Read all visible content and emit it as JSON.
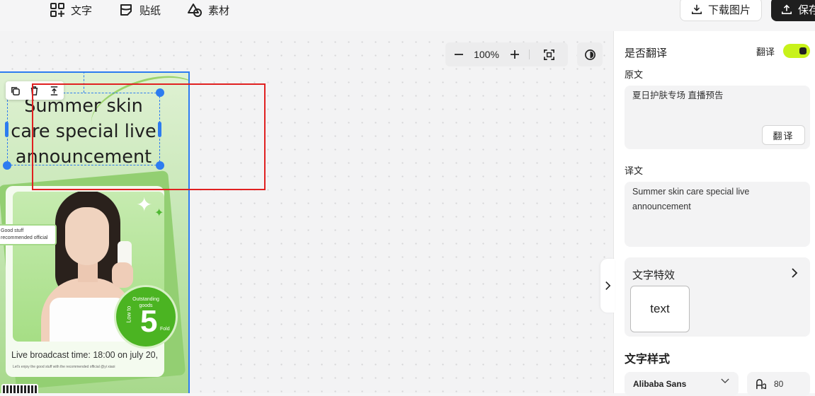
{
  "toolbar": {
    "text_label": "文字",
    "sticker_label": "贴纸",
    "material_label": "素材",
    "download_label": "下载图片",
    "save_label": "保存"
  },
  "canvas": {
    "zoom_level": "100%"
  },
  "poster": {
    "title_line1": "Summer skin",
    "title_line2": "care special live",
    "title_line3": "announcement",
    "sticker_line1": "Good stuff",
    "sticker_line2": "recommended official",
    "badge_top_line1": "Outstanding",
    "badge_top_line2": "goods",
    "badge_side": "Low to",
    "badge_number": "5",
    "badge_unit": "Fold",
    "live_time": "Live broadcast time: 18:00 on july 20,",
    "tiny_text": "Let's enjoy the good stuff with the recommended official @yi xiaoi"
  },
  "panel": {
    "translate_toggle_label": "是否翻译",
    "toggle_text": "翻译",
    "toggle_on": true,
    "source_label": "原文",
    "source_text": "夏日护肤专场 直播预告",
    "translate_button": "翻译",
    "translation_label": "译文",
    "translation_text": "Summer skin care special live announcement",
    "effects_label": "文字特效",
    "effect_tile": "text",
    "style_label": "文字样式",
    "font_name": "Alibaba Sans",
    "font_size": "80"
  },
  "colors": {
    "accent_blue": "#2d7cf0",
    "toggle_green": "#c8f21a",
    "highlight_red": "#e02020"
  }
}
